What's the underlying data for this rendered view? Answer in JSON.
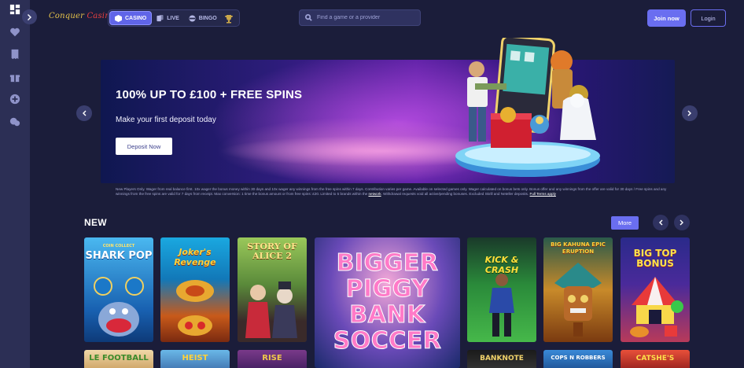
{
  "logo": {
    "text_a": "Conquer",
    "text_b": "Casino"
  },
  "header": {
    "tabs": [
      {
        "label": "CASINO",
        "icon": "cube-icon",
        "active": true
      },
      {
        "label": "LIVE",
        "icon": "cards-icon",
        "active": false
      },
      {
        "label": "BINGO",
        "icon": "bingo-ball-icon",
        "active": false
      }
    ],
    "search_placeholder": "Find a game or a provider",
    "join_label": "Join now",
    "login_label": "Login"
  },
  "sidebar": {
    "items": [
      "dashboard-icon",
      "heart-icon",
      "receipt-icon",
      "gift-icon",
      "plus-circle-icon",
      "chat-icon"
    ]
  },
  "hero": {
    "title": "100% UP TO £100 + FREE SPINS",
    "subtitle": "Make your first deposit today",
    "cta": "Deposit Now",
    "terms_text": "New Players Only. Wager from real balance first. 10x wager the bonus money within 30 days and 10x wager any winnings from the free spins within 7 days. Contribution varies per game. Available on selected games only. Wager calculated on bonus bets only. Bonus offer and any winnings from the offer are valid for 30 days / Free spins and any winnings from the free spins are valid for 7 days from receipt. Max conversion: 1 time the bonus amount or from free spins: £20. Limited to 5 brands within the",
    "terms_link": "network",
    "terms_tail": ". Withdrawal requests void all active/pending bonuses. Excluded Skrill and Neteller deposits.",
    "terms_link2": "Full Terms apply"
  },
  "section": {
    "title": "NEW",
    "more_label": "More"
  },
  "games": [
    {
      "name": "SHARK POP",
      "pre": "COIN COLLECT",
      "color1": "#3aa8e8",
      "color2": "#1453a8"
    },
    {
      "name": "Joker's Revenge",
      "pre": "",
      "color1": "#1b9bd8",
      "color2": "#d84a1a"
    },
    {
      "name": "STORY OF ALICE 2",
      "pre": "",
      "color1": "#7fb14a",
      "color2": "#3c5b2a"
    },
    {
      "name": "BIGGER PIGGY BANK SOCCER",
      "pre": "",
      "color1": "#f07fb8",
      "color2": "#2a3f8a"
    },
    {
      "name": "KICK & CRASH",
      "pre": "",
      "color1": "#2aa84a",
      "color2": "#0d4a24"
    },
    {
      "name": "BIG KAHUNA EPIC ERUPTION",
      "pre": "",
      "color1": "#d8a83a",
      "color2": "#2a7a4a"
    },
    {
      "name": "BIG TOP BONUS",
      "pre": "",
      "color1": "#3a2a8a",
      "color2": "#e8403a"
    }
  ],
  "games_row2": [
    "LE FOOTBALL",
    "HEIST",
    "RISE",
    "BANKNOTE",
    "COPS N ROBBERS",
    "CATSHE'S"
  ]
}
